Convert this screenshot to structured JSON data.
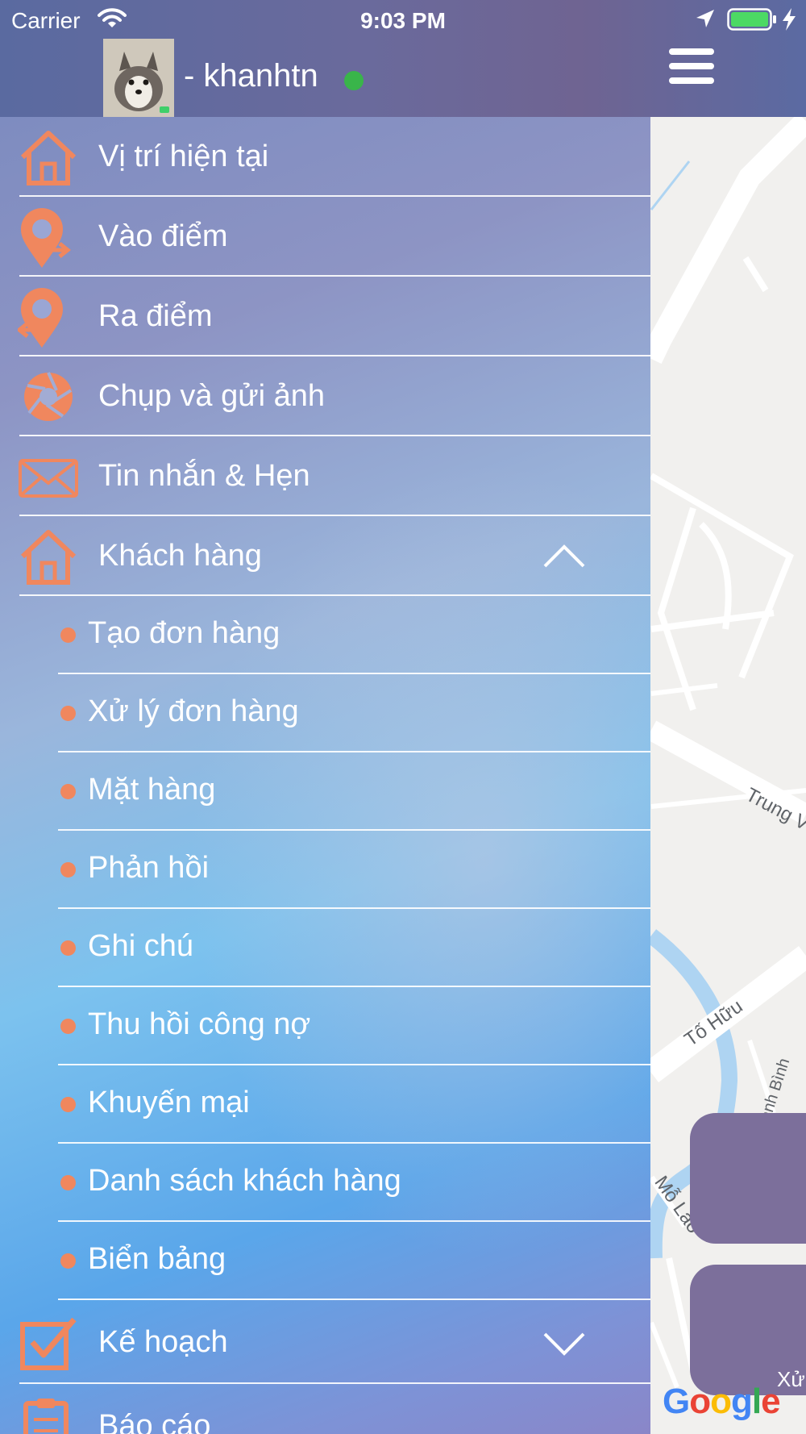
{
  "status_bar": {
    "carrier": "Carrier",
    "time": "9:03 PM"
  },
  "header": {
    "username": "- khanhtn",
    "online_status_color": "#39b54a"
  },
  "drawer": {
    "accent_color": "#f0875e",
    "menu": [
      {
        "id": "current-location",
        "label": "Vị trí hiện tại",
        "icon": "home-icon"
      },
      {
        "id": "check-in",
        "label": "Vào điểm",
        "icon": "map-pin-in-icon"
      },
      {
        "id": "check-out",
        "label": "Ra điểm",
        "icon": "map-pin-out-icon"
      },
      {
        "id": "photo",
        "label": "Chụp và gửi ảnh",
        "icon": "camera-shutter-icon"
      },
      {
        "id": "messages",
        "label": "Tin nhắn & Hẹn",
        "icon": "envelope-icon"
      },
      {
        "id": "customers",
        "label": "Khách hàng",
        "icon": "home-icon",
        "expanded": true
      }
    ],
    "customer_submenu": [
      "Tạo đơn hàng",
      "Xử lý đơn hàng",
      "Mặt hàng",
      "Phản hồi",
      "Ghi chú",
      "Thu hồi công nợ",
      "Khuyến mại",
      "Danh sách khách hàng",
      "Biển bảng"
    ],
    "menu_after": [
      {
        "id": "plan",
        "label": "Kế hoạch",
        "icon": "checkbox-icon",
        "expanded": false
      },
      {
        "id": "report",
        "label": "Báo cáo",
        "icon": "clipboard-icon"
      }
    ]
  },
  "map": {
    "street_labels": [
      "Trung V",
      "Tố Hữu",
      "Phố Thanh Bình",
      "Mỗ Lao"
    ],
    "attribution": "Google",
    "overlay_card_label": "Xử"
  }
}
